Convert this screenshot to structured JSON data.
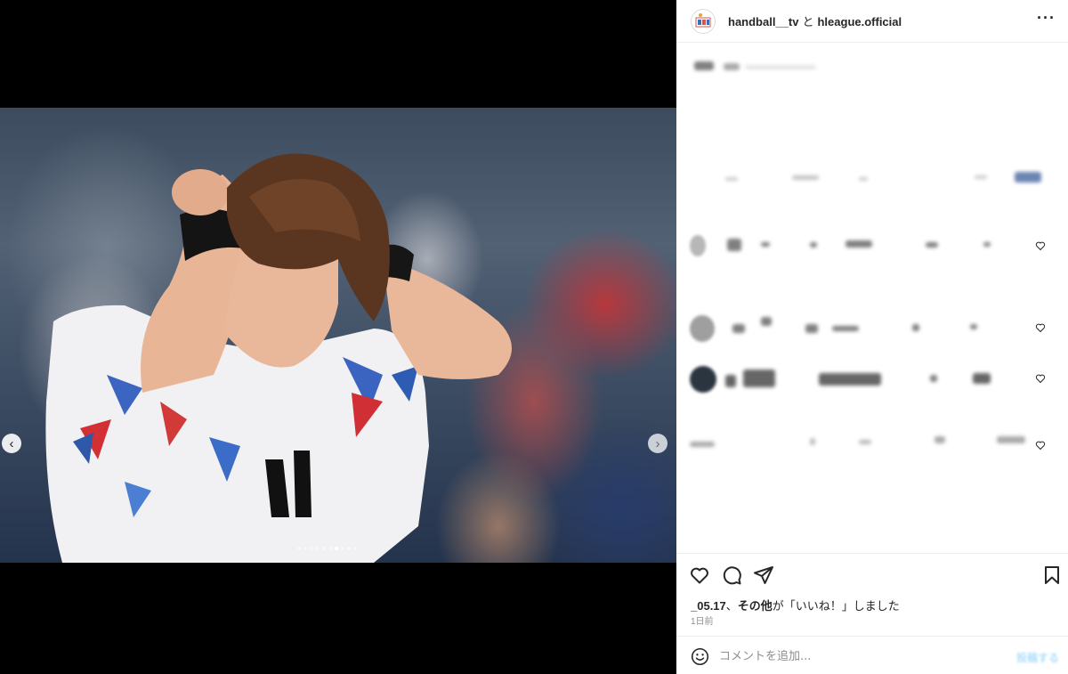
{
  "post": {
    "author": "handball__tv",
    "connector": "と",
    "collaborator": "hleague.official",
    "more_icon": "more-horizontal-icon"
  },
  "carousel": {
    "prev_icon": "chevron-left-icon",
    "next_icon": "chevron-right-icon",
    "prev_glyph": "‹",
    "next_glyph": "›",
    "slide_count": 10,
    "active_index": 6
  },
  "actions": {
    "like_icon": "heart-icon",
    "comment_icon": "comment-icon",
    "share_icon": "send-icon",
    "save_icon": "bookmark-icon"
  },
  "likes": {
    "user": "_05.17",
    "separator": "、",
    "others": "その他",
    "suffix": "が「いいね！」しました"
  },
  "timestamp": "1日前",
  "comment_box": {
    "placeholder": "コメントを追加...",
    "post_label": "投稿する",
    "emoji_icon": "smiley-icon"
  },
  "colors": {
    "panel_bg": "#ffffff",
    "text": "#262626",
    "muted": "#8e8e8e",
    "post_button": "#b2dffc",
    "divider": "#efefef"
  }
}
